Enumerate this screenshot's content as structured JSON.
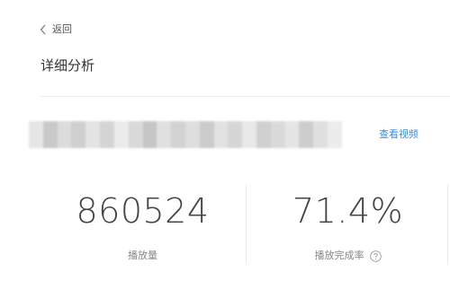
{
  "nav": {
    "back_label": "返回"
  },
  "page": {
    "title": "详细分析"
  },
  "video": {
    "view_link_label": "查看视频",
    "link_color": "#3a8ee6"
  },
  "stats": [
    {
      "value": "860524",
      "label": "播放量",
      "has_help": false
    },
    {
      "value": "71.4%",
      "label": "播放完成率",
      "has_help": true
    }
  ],
  "icons": {
    "back": "chevron-left-icon",
    "help": "question-circle-icon"
  }
}
